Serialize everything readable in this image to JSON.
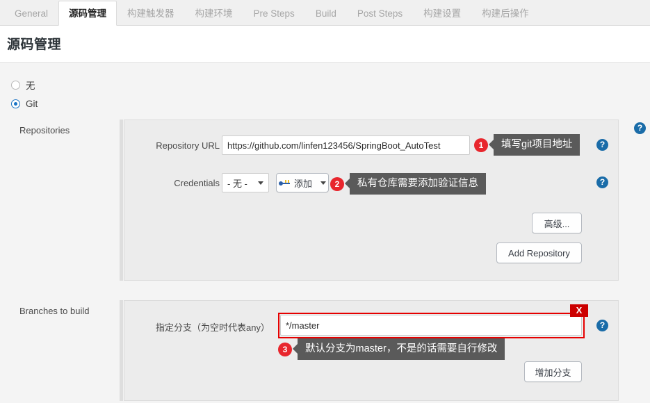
{
  "tabs": [
    {
      "label": "General",
      "active": false
    },
    {
      "label": "源码管理",
      "active": true
    },
    {
      "label": "构建触发器",
      "active": false
    },
    {
      "label": "构建环境",
      "active": false
    },
    {
      "label": "Pre Steps",
      "active": false
    },
    {
      "label": "Build",
      "active": false
    },
    {
      "label": "Post Steps",
      "active": false
    },
    {
      "label": "构建设置",
      "active": false
    },
    {
      "label": "构建后操作",
      "active": false
    }
  ],
  "page": {
    "title": "源码管理"
  },
  "scm_options": [
    {
      "label": "无",
      "selected": false
    },
    {
      "label": "Git",
      "selected": true
    }
  ],
  "repositories": {
    "section_label": "Repositories",
    "repository_url": {
      "label": "Repository URL",
      "value": "https://github.com/linfen123456/SpringBoot_AutoTest",
      "help": "?"
    },
    "credentials": {
      "label": "Credentials",
      "selected": "- 无 -",
      "add_button": "添加",
      "add_icon": "key-icon",
      "help": "?"
    },
    "advanced_button": "高级...",
    "add_repository_button": "Add Repository",
    "section_help": "?"
  },
  "branches": {
    "section_label": "Branches to build",
    "branch_specifier": {
      "label": "指定分支（为空时代表any）",
      "value": "*/master",
      "help": "?"
    },
    "add_branch_button": "增加分支",
    "error_marker": "X"
  },
  "annotations": [
    {
      "number": "1",
      "text": "填写git项目地址"
    },
    {
      "number": "2",
      "text": "私有仓库需要添加验证信息"
    },
    {
      "number": "3",
      "text": "默认分支为master，不是的话需要自行修改"
    }
  ],
  "colors": {
    "accent_blue": "#1b74c4",
    "help_blue": "#1a6ca8",
    "annotation_red": "#e8262d",
    "error_red": "#cc0000",
    "callout_gray": "#5a5a5a"
  }
}
